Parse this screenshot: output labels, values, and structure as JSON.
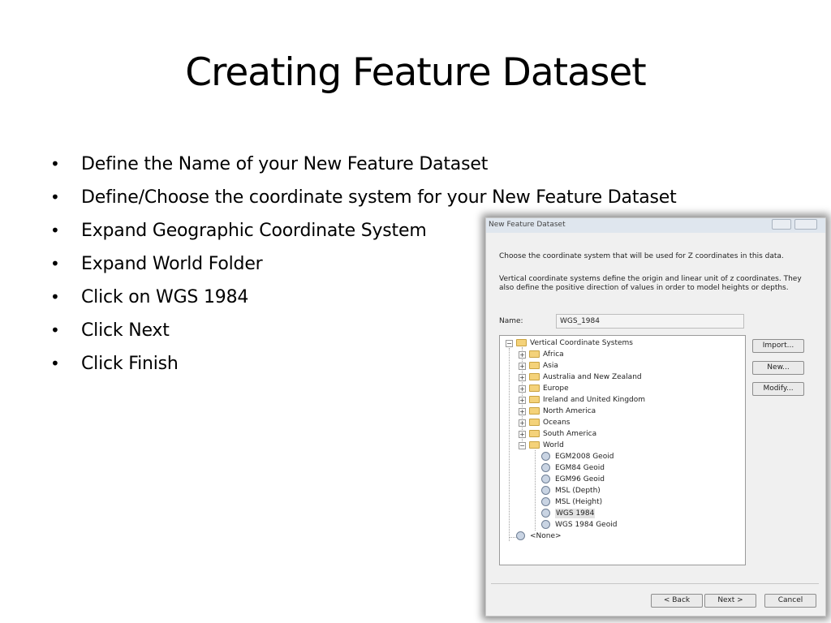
{
  "slide": {
    "title": "Creating Feature Dataset",
    "bullets": [
      "Define the Name of your New Feature Dataset",
      "Define/Choose the coordinate system for your New Feature Dataset",
      "Expand Geographic Coordinate System",
      "Expand World Folder",
      "Click on WGS 1984",
      "Click Next",
      "Click Finish"
    ]
  },
  "dialog": {
    "title": "New Feature Dataset",
    "instruction": "Choose the coordinate system that will be used for Z coordinates in this data.",
    "description": "Vertical coordinate systems define the origin and linear unit of z coordinates. They also define the positive direction of values in order to model heights or depths.",
    "name_label": "Name:",
    "name_value": "WGS_1984",
    "tree": {
      "root": "Vertical Coordinate Systems",
      "folders": [
        "Africa",
        "Asia",
        "Australia and New Zealand",
        "Europe",
        "Ireland and United Kingdom",
        "North America",
        "Oceans",
        "South America",
        "World"
      ],
      "world_items": [
        "EGM2008 Geoid",
        "EGM84 Geoid",
        "EGM96 Geoid",
        "MSL (Depth)",
        "MSL (Height)",
        "WGS 1984",
        "WGS 1984 Geoid"
      ],
      "selected": "WGS 1984",
      "none_item": "<None>"
    },
    "buttons": {
      "import": "Import...",
      "new": "New...",
      "modify": "Modify...",
      "back": "< Back",
      "next": "Next >",
      "cancel": "Cancel"
    }
  }
}
